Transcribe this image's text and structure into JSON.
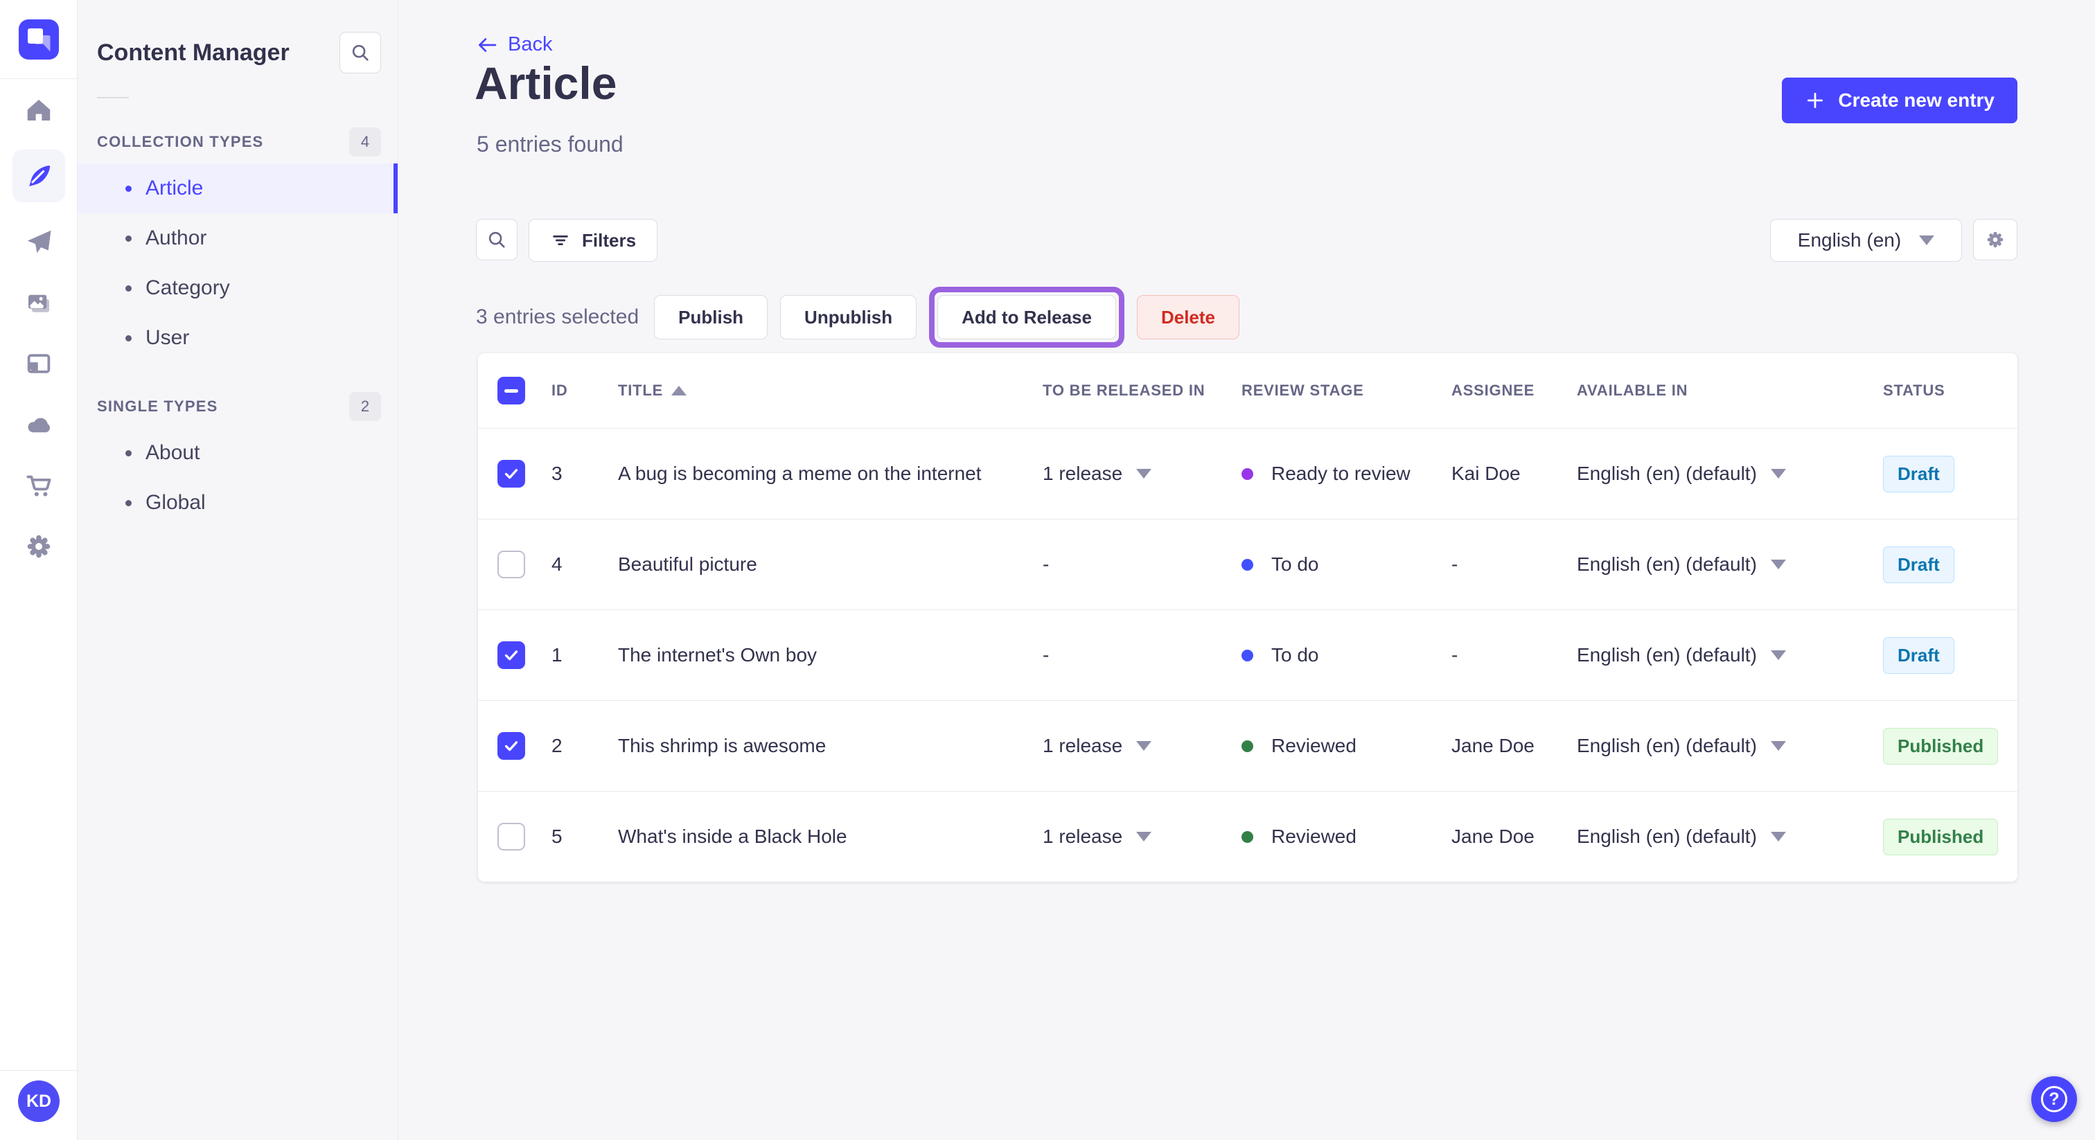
{
  "colors": {
    "accent": "#4945ff",
    "active_bg": "#f0f0ff",
    "draft_text": "#0c75af",
    "published_text": "#328048",
    "delete_text": "#d02b20",
    "release_ring": "#9b63e0",
    "dot_ready_to_review": "#9736e8",
    "dot_to_do": "#4050ff",
    "dot_reviewed": "#328048"
  },
  "rail": {
    "avatar_initials": "KD",
    "icons": [
      "home-icon",
      "feather-icon",
      "send-icon",
      "media-icon",
      "layout-icon",
      "cloud-icon",
      "cart-icon",
      "gear-icon"
    ]
  },
  "panel": {
    "title": "Content Manager",
    "collection_section": {
      "label": "COLLECTION TYPES",
      "badge": "4",
      "items": [
        {
          "label": "Article"
        },
        {
          "label": "Author"
        },
        {
          "label": "Category"
        },
        {
          "label": "User"
        }
      ]
    },
    "single_section": {
      "label": "SINGLE TYPES",
      "badge": "2",
      "items": [
        {
          "label": "About"
        },
        {
          "label": "Global"
        }
      ]
    }
  },
  "header": {
    "back_label": "Back",
    "title": "Article",
    "subtitle": "5 entries found",
    "create_label": "Create new entry"
  },
  "toolbar": {
    "filters_label": "Filters",
    "locale_value": "English (en)"
  },
  "selection": {
    "count_text": "3 entries selected",
    "publish_label": "Publish",
    "unpublish_label": "Unpublish",
    "add_to_release_label": "Add to Release",
    "delete_label": "Delete"
  },
  "table": {
    "headers": {
      "id": "ID",
      "title": "TITLE",
      "released": "TO BE RELEASED IN",
      "review": "REVIEW STAGE",
      "assignee": "ASSIGNEE",
      "available": "AVAILABLE IN",
      "status": "STATUS"
    },
    "rows": [
      {
        "checked": true,
        "id": "3",
        "title": "A bug is becoming a meme on the internet",
        "released": "1 release",
        "review": "Ready to review",
        "review_color": "#9736e8",
        "assignee": "Kai Doe",
        "available": "English (en) (default)",
        "status": "Draft",
        "status_variant": "draft"
      },
      {
        "checked": false,
        "id": "4",
        "title": "Beautiful picture",
        "released": "-",
        "review": "To do",
        "review_color": "#4050ff",
        "assignee": "-",
        "available": "English (en) (default)",
        "status": "Draft",
        "status_variant": "draft"
      },
      {
        "checked": true,
        "id": "1",
        "title": "The internet's Own boy",
        "released": "-",
        "review": "To do",
        "review_color": "#4050ff",
        "assignee": "-",
        "available": "English (en) (default)",
        "status": "Draft",
        "status_variant": "draft"
      },
      {
        "checked": true,
        "id": "2",
        "title": "This shrimp is awesome",
        "released": "1 release",
        "review": "Reviewed",
        "review_color": "#328048",
        "assignee": "Jane Doe",
        "available": "English (en) (default)",
        "status": "Published",
        "status_variant": "published"
      },
      {
        "checked": false,
        "id": "5",
        "title": "What's inside a Black Hole",
        "released": "1 release",
        "review": "Reviewed",
        "review_color": "#328048",
        "assignee": "Jane Doe",
        "available": "English (en) (default)",
        "status": "Published",
        "status_variant": "published"
      }
    ]
  },
  "help": {
    "glyph": "?"
  }
}
